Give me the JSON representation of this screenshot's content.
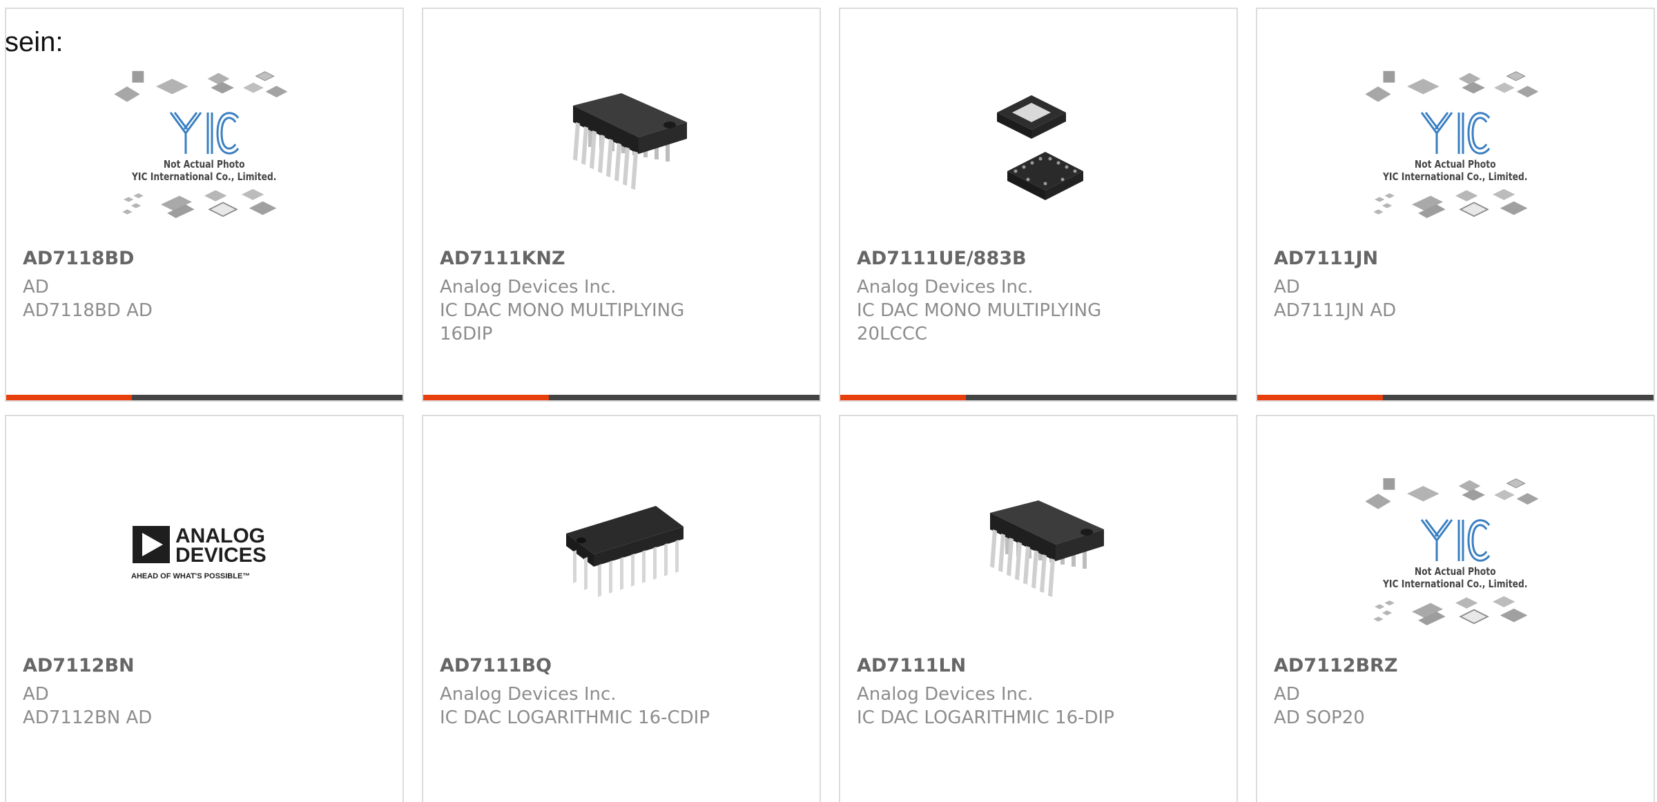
{
  "intro": "sein:",
  "colors": {
    "accent": "#e8400c",
    "bar": "#444444",
    "yic_blue": "#3a7fc1"
  },
  "yic_placeholder": {
    "line1": "Not Actual Photo",
    "line2": "YIC International Co., Limited."
  },
  "analog_logo": {
    "line1": "ANALOG",
    "line2": "DEVICES",
    "tagline": "AHEAD OF WHAT'S POSSIBLE™"
  },
  "products": [
    {
      "part": "AD7118BD",
      "manufacturer": "AD",
      "description": "AD7118BD AD",
      "image": "yic-placeholder"
    },
    {
      "part": "AD7111KNZ",
      "manufacturer": "Analog Devices Inc.",
      "description": "IC DAC MONO MULTIPLYING 16DIP",
      "image": "dip-chip"
    },
    {
      "part": "AD7111UE/883B",
      "manufacturer": "Analog Devices Inc.",
      "description": "IC DAC MONO MULTIPLYING 20LCCC",
      "image": "lccc-chip"
    },
    {
      "part": "AD7111JN",
      "manufacturer": "AD",
      "description": "AD7111JN AD",
      "image": "yic-placeholder"
    },
    {
      "part": "AD7112BN",
      "manufacturer": "AD",
      "description": "AD7112BN AD",
      "image": "analog-devices-logo"
    },
    {
      "part": "AD7111BQ",
      "manufacturer": "Analog Devices Inc.",
      "description": "IC DAC LOGARITHMIC 16-CDIP",
      "image": "cdip-chip"
    },
    {
      "part": "AD7111LN",
      "manufacturer": "Analog Devices Inc.",
      "description": "IC DAC LOGARITHMIC 16-DIP",
      "image": "dip-chip"
    },
    {
      "part": "AD7112BRZ",
      "manufacturer": "AD",
      "description": "AD SOP20",
      "image": "yic-placeholder"
    }
  ]
}
